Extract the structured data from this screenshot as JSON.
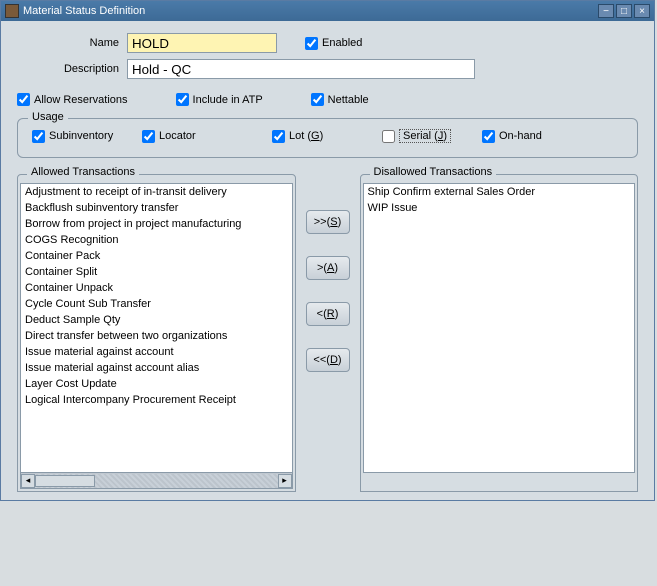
{
  "window": {
    "title": "Material Status Definition"
  },
  "form": {
    "name_label": "Name",
    "name_value": "HOLD",
    "desc_label": "Description",
    "desc_value": "Hold - QC",
    "enabled_label": "Enabled",
    "enabled_checked": true
  },
  "options": {
    "allow_reservations": {
      "label": "Allow Reservations",
      "checked": true
    },
    "include_atp": {
      "label": "Include in ATP",
      "checked": true
    },
    "nettable": {
      "label": "Nettable",
      "checked": true
    }
  },
  "usage": {
    "legend": "Usage",
    "subinventory": {
      "label": "Subinventory",
      "checked": true
    },
    "locator": {
      "label": "Locator",
      "checked": true
    },
    "lot": {
      "prefix": "Lot (",
      "accel": "G",
      "suffix": ")",
      "checked": true
    },
    "serial": {
      "prefix": "Serial (",
      "accel": "J",
      "suffix": ")",
      "checked": false
    },
    "onhand": {
      "label": "On-hand",
      "checked": true
    }
  },
  "allowed": {
    "legend": "Allowed Transactions",
    "items": [
      "Adjustment to receipt of in-transit delivery",
      "Backflush subinventory transfer",
      "Borrow from project in project manufacturing",
      "COGS Recognition",
      "Container Pack",
      "Container Split",
      "Container Unpack",
      "Cycle Count Sub Transfer",
      "Deduct Sample Qty",
      "Direct transfer between two organizations",
      "Issue material against account",
      "Issue material against account alias",
      "Layer Cost Update",
      "Logical Intercompany Procurement Receipt"
    ]
  },
  "disallowed": {
    "legend": "Disallowed Transactions",
    "items": [
      "Ship Confirm external Sales Order",
      "WIP Issue"
    ]
  },
  "buttons": {
    "all_right": {
      "prefix": ">>(",
      "accel": "S",
      "suffix": ")"
    },
    "one_right": {
      "prefix": ">(",
      "accel": "A",
      "suffix": ")"
    },
    "one_left": {
      "prefix": "<(",
      "accel": "R",
      "suffix": ")"
    },
    "all_left": {
      "prefix": "<<(",
      "accel": "D",
      "suffix": ")"
    }
  }
}
